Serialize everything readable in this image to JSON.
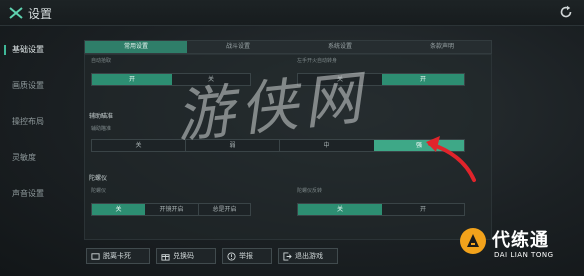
{
  "header": {
    "title": "设置"
  },
  "sidebar": {
    "items": [
      {
        "label": "基础设置",
        "active": true
      },
      {
        "label": "画质设置",
        "active": false
      },
      {
        "label": "操控布局",
        "active": false
      },
      {
        "label": "灵敏度",
        "active": false
      },
      {
        "label": "声音设置",
        "active": false
      }
    ]
  },
  "tabs": [
    {
      "label": "常用设置",
      "active": true
    },
    {
      "label": "战斗设置",
      "active": false
    },
    {
      "label": "系统设置",
      "active": false
    },
    {
      "label": "条款声明",
      "active": false
    }
  ],
  "top_row": {
    "left_label": "自动拾取",
    "left_options": [
      "开",
      "关"
    ],
    "right_label": "左手开火自动转身",
    "right_options": [
      "关",
      "开"
    ]
  },
  "aim_assist": {
    "section_title": "辅助瞄准",
    "label": "辅助瞄准",
    "options": [
      "关",
      "弱",
      "中",
      "强"
    ],
    "selected": "强"
  },
  "gyro": {
    "section_title": "陀螺仪",
    "left_label": "陀螺仪",
    "left_options": [
      "关",
      "开镜开启",
      "总是开启"
    ],
    "left_selected": "关",
    "right_label": "陀螺仪反转",
    "right_options": [
      "关",
      "开"
    ],
    "right_selected": "关"
  },
  "bottom_buttons": [
    {
      "label": "脱离卡死",
      "icon": "card-icon"
    },
    {
      "label": "兑换码",
      "icon": "gift-icon"
    },
    {
      "label": "举报",
      "icon": "report-icon"
    },
    {
      "label": "退出游戏",
      "icon": "exit-icon"
    }
  ],
  "watermark": {
    "text": "游侠网"
  },
  "brand": {
    "name": "代练通",
    "subtitle": "DAI LIAN TONG"
  },
  "colors": {
    "accent": "#2d8e72",
    "accent_bright": "#3ea887",
    "background": "#1b2023",
    "arrow": "#e0242b",
    "brand_orange": "#f2a21b"
  }
}
